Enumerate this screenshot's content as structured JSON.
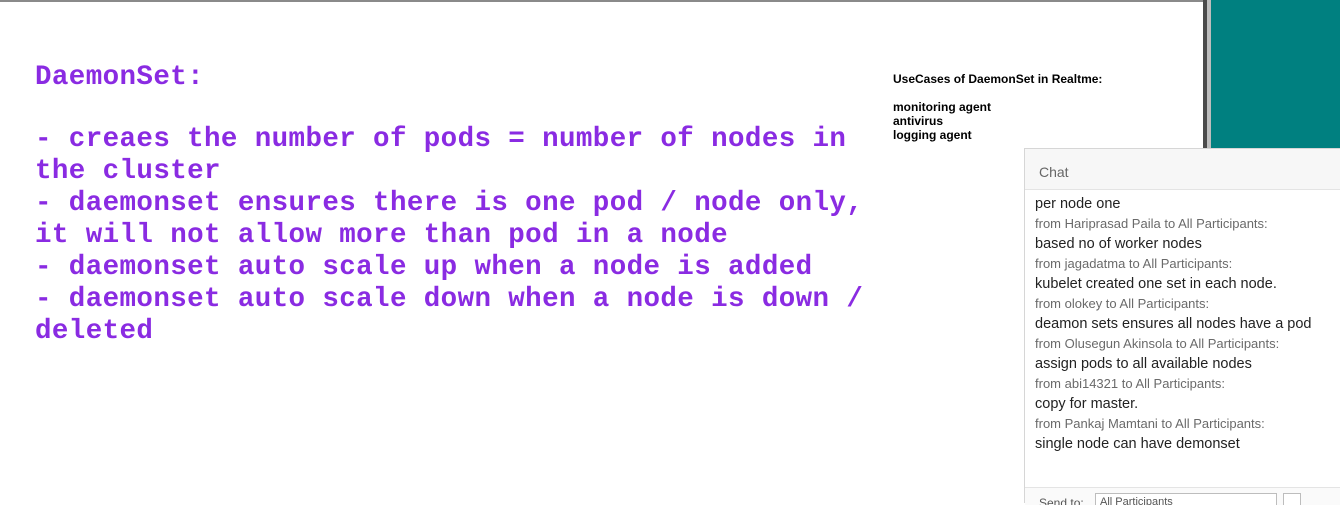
{
  "slide": {
    "title": "DaemonSet:",
    "bullets": [
      "- creaes the number of pods = number of nodes in\nthe cluster",
      "- daemonset ensures there is one pod / node only,\nit will not allow more than pod in a node",
      "- daemonset auto scale up when a node is added",
      "- daemonset auto scale down when a node is down /\ndeleted"
    ],
    "text_color": "#8a2be2"
  },
  "usecases": {
    "title": "UseCases of DaemonSet in Realtme:",
    "items": [
      "monitoring agent",
      "antivirus",
      "logging agent"
    ]
  },
  "chat": {
    "header": "Chat",
    "messages": [
      {
        "text": "per node one"
      },
      {
        "from": "from Hariprasad Paila to All Participants:",
        "text": "based no of worker nodes"
      },
      {
        "from": "from jagadatma to All Participants:",
        "text": "kubelet created one set in each node."
      },
      {
        "from": "from olokey to All Participants:",
        "text": "deamon sets ensures all nodes have a pod"
      },
      {
        "from": "from Olusegun Akinsola to All Participants:",
        "text": "assign pods to all available nodes"
      },
      {
        "from": "from abi14321 to All Participants:",
        "text": "copy for master."
      },
      {
        "from": "from Pankaj Mamtani to All Participants:",
        "text": "single node can have demonset"
      }
    ],
    "send_to_label": "Send to:",
    "send_to_value": "All Participants"
  },
  "colors": {
    "teal": "#008080"
  }
}
